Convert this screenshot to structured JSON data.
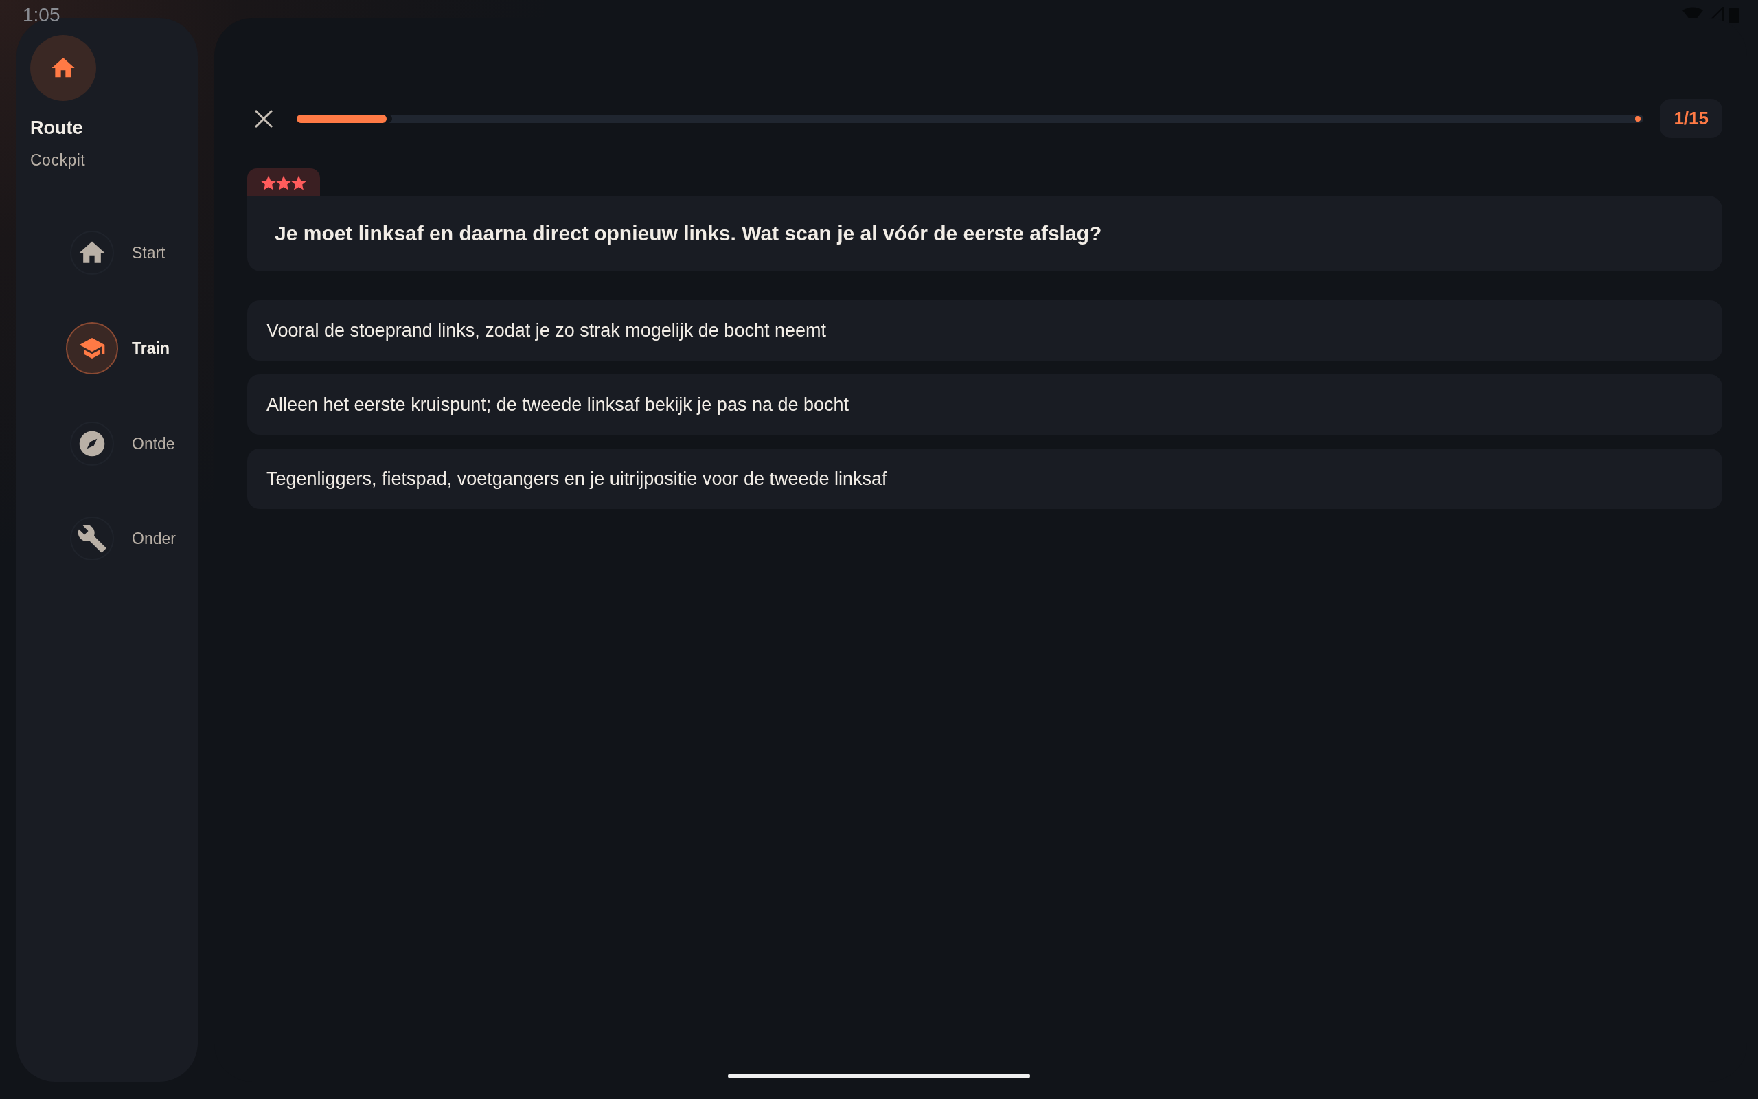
{
  "status_bar": {
    "time": "1:05"
  },
  "sidebar": {
    "app_title": "Route",
    "app_subtitle": "Cockpit",
    "items": [
      {
        "label": "Start",
        "selected": false
      },
      {
        "label": "Train",
        "selected": true
      },
      {
        "label": "Ontde",
        "selected": false
      },
      {
        "label": "Onder",
        "selected": false
      }
    ]
  },
  "quiz": {
    "progress": {
      "level": 0.067
    },
    "counter": "1/15",
    "difficulty": {
      "stars": 3
    },
    "question": "Je moet linksaf en daarna direct opnieuw links. Wat scan je al vóór de eerste afslag?",
    "answers": [
      {
        "text": "Vooral de stoeprand links, zodat je zo strak mogelijk de bocht neemt",
        "selected": false
      },
      {
        "text": "Alleen het eerste kruispunt; de tweede linksaf bekijk je pas na de bocht",
        "selected": false
      },
      {
        "text": "Tegenliggers, fietspad, voetgangers en je uitrijpositie voor de tweede linksaf",
        "selected": false
      }
    ]
  }
}
